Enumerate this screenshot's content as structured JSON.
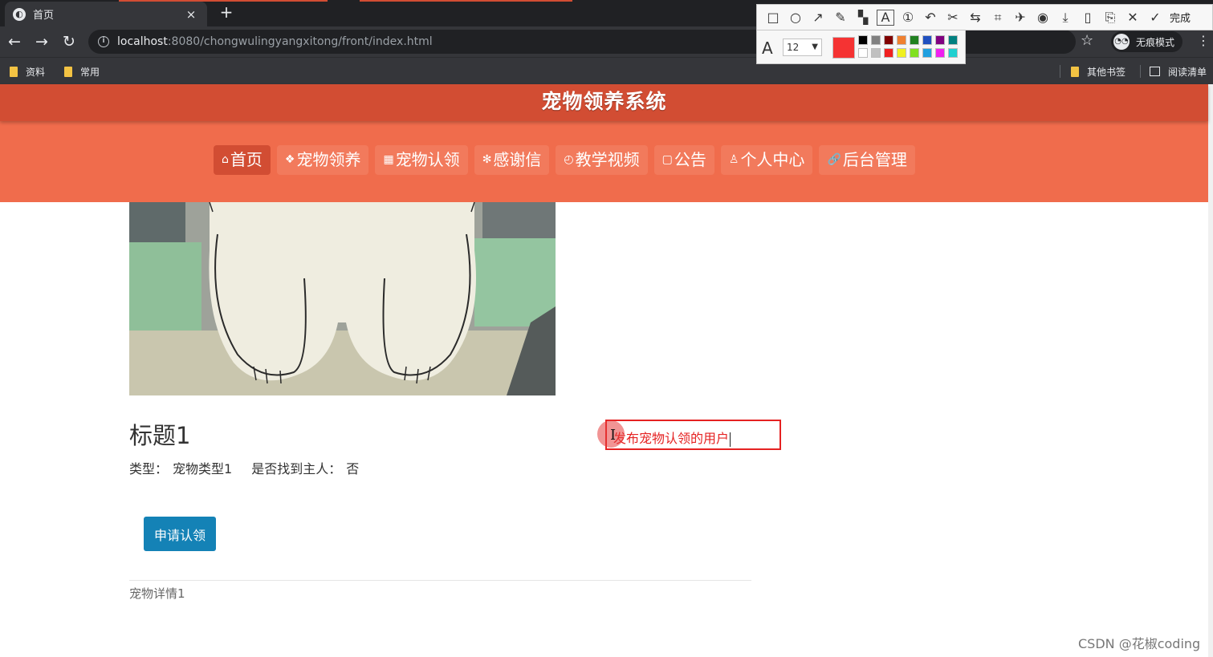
{
  "browser": {
    "tab_title": "首页",
    "tab_close": "×",
    "new_tab": "+",
    "url_host": "localhost",
    "url_path": ":8080/chongwulingyangxitong/front/index.html",
    "incognito_label": "无痕模式",
    "icons": [
      "back-arrow-icon",
      "forward-arrow-icon",
      "reload-icon",
      "info-icon",
      "star-icon",
      "incognito-icon",
      "menu-kebab-icon"
    ]
  },
  "bookmarks": {
    "left": [
      {
        "label": "资料"
      },
      {
        "label": "常用"
      }
    ],
    "other": "其他书签",
    "reading_list": "阅读清单"
  },
  "annotation_tool": {
    "done_label": "完成",
    "font_size": "12",
    "current_color": "#f53333",
    "palette_top": [
      "#000000",
      "#808080",
      "#800000",
      "#f08030",
      "#208020",
      "#2050c0",
      "#800080",
      "#008080"
    ],
    "palette_bottom": [
      "#ffffff",
      "#c0c0c0",
      "#f02020",
      "#f0f020",
      "#80e020",
      "#20a0e0",
      "#f020f0",
      "#20d0d0"
    ],
    "tools": [
      "rectangle-icon",
      "ellipse-icon",
      "arrow-icon",
      "pencil-icon",
      "mosaic-icon",
      "text-icon",
      "number-icon",
      "undo-icon",
      "cut-icon",
      "translate-icon",
      "ocr-icon",
      "pin-icon",
      "record-icon",
      "download-icon",
      "save-icon",
      "bookmark-icon",
      "close-icon",
      "check-icon"
    ],
    "text_box_content": "发布宠物认领的用户"
  },
  "site": {
    "title": "宠物领养系统",
    "nav": [
      {
        "icon": "⌂",
        "label": "首页",
        "active": true
      },
      {
        "icon": "❖",
        "label": "宠物领养"
      },
      {
        "icon": "▦",
        "label": "宠物认领"
      },
      {
        "icon": "✻",
        "label": "感谢信"
      },
      {
        "icon": "◴",
        "label": "教学视频"
      },
      {
        "icon": "▢",
        "label": "公告"
      },
      {
        "icon": "♙",
        "label": "个人中心"
      },
      {
        "icon": "🔗",
        "label": "后台管理"
      }
    ]
  },
  "detail": {
    "title": "标题1",
    "type_label": "类型：",
    "type_value": "宠物类型1",
    "found_label": "是否找到主人：",
    "found_value": "否",
    "apply_button": "申请认领",
    "description": "宠物详情1"
  },
  "watermark": "CSDN @花椒coding",
  "colors": {
    "header": "#d24d33",
    "nav_band": "#f06c4c",
    "button": "#1482b6",
    "annotation_red": "#e52222"
  }
}
